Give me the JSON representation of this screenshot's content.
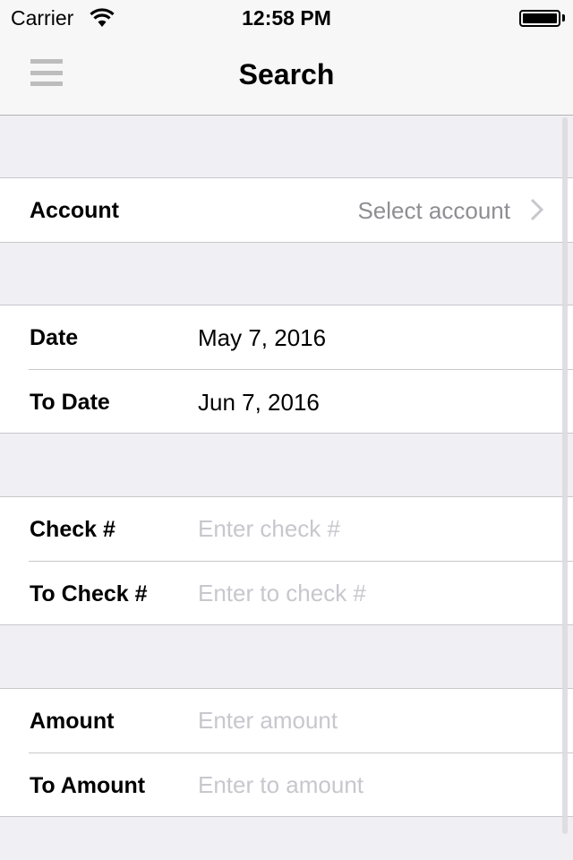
{
  "status_bar": {
    "carrier": "Carrier",
    "time": "12:58 PM",
    "wifi_icon": "wifi-icon",
    "battery_icon": "battery-full-icon",
    "battery_level_percent": 100
  },
  "nav_bar": {
    "title": "Search",
    "menu_icon": "hamburger-menu-icon"
  },
  "form": {
    "account": {
      "label": "Account",
      "value": "Select account",
      "accessory_icon": "chevron-right-icon"
    },
    "date": {
      "label": "Date",
      "value": "May 7, 2016"
    },
    "to_date": {
      "label": "To Date",
      "value": "Jun 7, 2016"
    },
    "check": {
      "label": "Check #",
      "value": "",
      "placeholder": "Enter check #"
    },
    "to_check": {
      "label": "To Check #",
      "value": "",
      "placeholder": "Enter to check #"
    },
    "amount": {
      "label": "Amount",
      "value": "",
      "placeholder": "Enter amount"
    },
    "to_amount": {
      "label": "To Amount",
      "value": "",
      "placeholder": "Enter to amount"
    }
  },
  "colors": {
    "background": "#efeff4",
    "separator": "#c8c7cc",
    "placeholder": "#c7c7cd",
    "secondary_text": "#8e8e93",
    "menu_icon": "#bdbdbd"
  }
}
